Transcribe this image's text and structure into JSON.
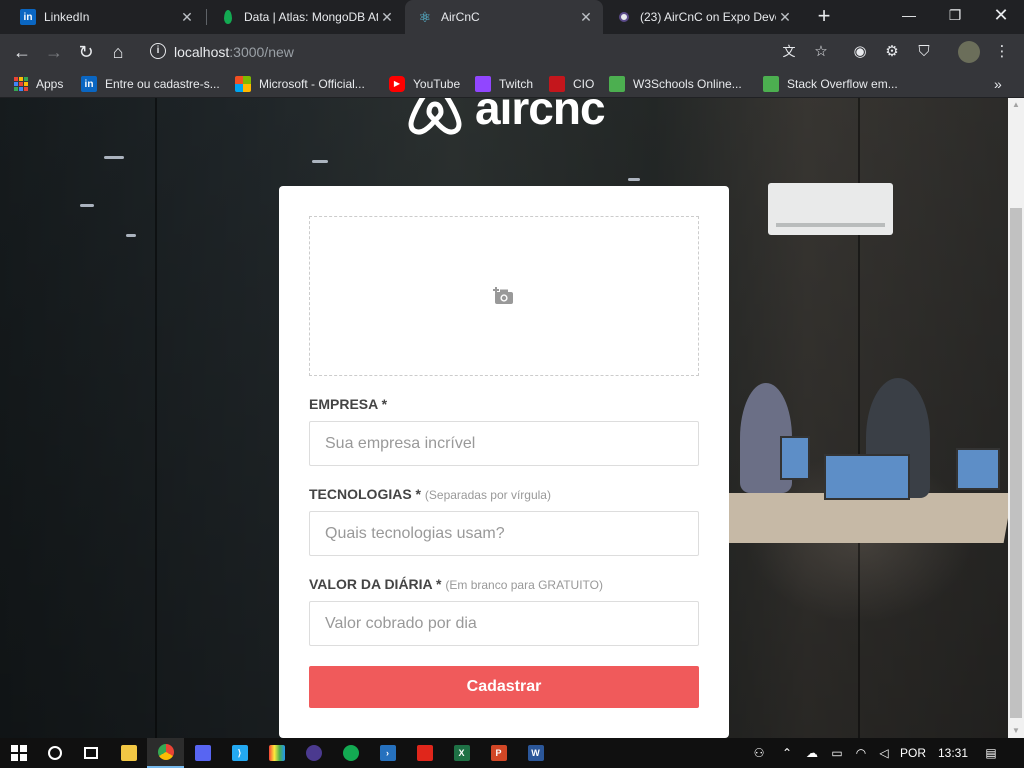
{
  "tabs": [
    {
      "title": "LinkedIn",
      "active": false
    },
    {
      "title": "Data | Atlas: MongoDB At",
      "active": false
    },
    {
      "title": "AirCnC",
      "active": true
    },
    {
      "title": "(23) AirCnC on Expo Deve",
      "active": false
    }
  ],
  "omnibox": {
    "host": "localhost",
    "path": ":3000/new"
  },
  "bookmarks": [
    {
      "label": "Apps"
    },
    {
      "label": "Entre ou cadastre-s..."
    },
    {
      "label": "Microsoft - Official..."
    },
    {
      "label": "YouTube"
    },
    {
      "label": "Twitch"
    },
    {
      "label": "CIO"
    },
    {
      "label": "W3Schools Online..."
    },
    {
      "label": "Stack Overflow em..."
    }
  ],
  "logo_text": "aircnc",
  "form": {
    "empresa": {
      "label": "EMPRESA *",
      "placeholder": "Sua empresa incrível"
    },
    "tecnologias": {
      "label": "TECNOLOGIAS *",
      "hint": "(Separadas por vírgula)",
      "placeholder": "Quais tecnologias usam?"
    },
    "valor": {
      "label": "VALOR DA DIÁRIA *",
      "hint": "(Em branco para GRATUITO)",
      "placeholder": "Valor cobrado por dia"
    },
    "submit_label": "Cadastrar"
  },
  "colors": {
    "accent": "#f05a5b",
    "tab_bg": "#202124",
    "toolbar_bg": "#35363a"
  },
  "taskbar": {
    "language": "POR",
    "time": "13:31"
  }
}
